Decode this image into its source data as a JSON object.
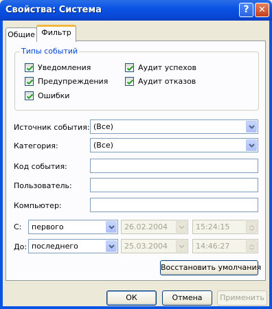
{
  "window": {
    "title": "Свойства: Система"
  },
  "titlebar": {
    "help_glyph": "?",
    "close_glyph": "✕"
  },
  "tabs": [
    {
      "label": "Общие",
      "active": false
    },
    {
      "label": "Фильтр",
      "active": true
    }
  ],
  "event_types": {
    "title": "Типы событий",
    "items": [
      {
        "label": "Уведомления",
        "checked": true
      },
      {
        "label": "Предупреждения",
        "checked": true
      },
      {
        "label": "Ошибки",
        "checked": true
      },
      {
        "label": "Аудит успехов",
        "checked": true
      },
      {
        "label": "Аудит отказов",
        "checked": true
      }
    ]
  },
  "fields": {
    "source": {
      "label": "Источник события:",
      "value": "(Все)"
    },
    "category": {
      "label": "Категория:",
      "value": "(Все)"
    },
    "event_id": {
      "label": "Код события:",
      "value": ""
    },
    "user": {
      "label": "Пользователь:",
      "value": ""
    },
    "computer": {
      "label": "Компьютер:",
      "value": ""
    }
  },
  "range": {
    "from": {
      "label": "С:",
      "mode": "первого",
      "date": "26.02.2004",
      "time": "15:24:15"
    },
    "to": {
      "label": "До:",
      "mode": "последнего",
      "date": "25.03.2004",
      "time": "14:46:27"
    }
  },
  "buttons": {
    "restore_defaults": "Восстановить умолчания",
    "ok": "ОК",
    "cancel": "Отмена",
    "apply": "Применить"
  },
  "colors": {
    "titlebar": "#0a54e4",
    "face": "#ece9d8",
    "group_title": "#0046d5",
    "check": "#21a121"
  }
}
